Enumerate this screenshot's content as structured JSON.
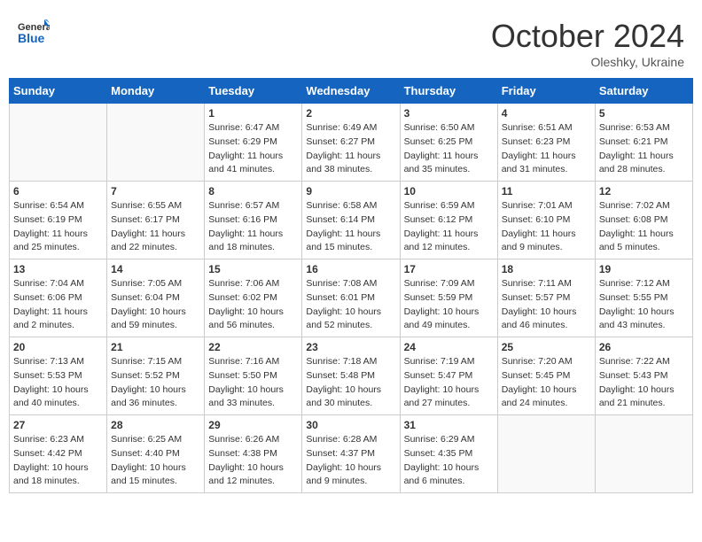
{
  "header": {
    "logo_line1": "General",
    "logo_line2": "Blue",
    "month": "October 2024",
    "location": "Oleshky, Ukraine"
  },
  "weekdays": [
    "Sunday",
    "Monday",
    "Tuesday",
    "Wednesday",
    "Thursday",
    "Friday",
    "Saturday"
  ],
  "weeks": [
    [
      {
        "day": "",
        "info": ""
      },
      {
        "day": "",
        "info": ""
      },
      {
        "day": "1",
        "info": "Sunrise: 6:47 AM\nSunset: 6:29 PM\nDaylight: 11 hours and 41 minutes."
      },
      {
        "day": "2",
        "info": "Sunrise: 6:49 AM\nSunset: 6:27 PM\nDaylight: 11 hours and 38 minutes."
      },
      {
        "day": "3",
        "info": "Sunrise: 6:50 AM\nSunset: 6:25 PM\nDaylight: 11 hours and 35 minutes."
      },
      {
        "day": "4",
        "info": "Sunrise: 6:51 AM\nSunset: 6:23 PM\nDaylight: 11 hours and 31 minutes."
      },
      {
        "day": "5",
        "info": "Sunrise: 6:53 AM\nSunset: 6:21 PM\nDaylight: 11 hours and 28 minutes."
      }
    ],
    [
      {
        "day": "6",
        "info": "Sunrise: 6:54 AM\nSunset: 6:19 PM\nDaylight: 11 hours and 25 minutes."
      },
      {
        "day": "7",
        "info": "Sunrise: 6:55 AM\nSunset: 6:17 PM\nDaylight: 11 hours and 22 minutes."
      },
      {
        "day": "8",
        "info": "Sunrise: 6:57 AM\nSunset: 6:16 PM\nDaylight: 11 hours and 18 minutes."
      },
      {
        "day": "9",
        "info": "Sunrise: 6:58 AM\nSunset: 6:14 PM\nDaylight: 11 hours and 15 minutes."
      },
      {
        "day": "10",
        "info": "Sunrise: 6:59 AM\nSunset: 6:12 PM\nDaylight: 11 hours and 12 minutes."
      },
      {
        "day": "11",
        "info": "Sunrise: 7:01 AM\nSunset: 6:10 PM\nDaylight: 11 hours and 9 minutes."
      },
      {
        "day": "12",
        "info": "Sunrise: 7:02 AM\nSunset: 6:08 PM\nDaylight: 11 hours and 5 minutes."
      }
    ],
    [
      {
        "day": "13",
        "info": "Sunrise: 7:04 AM\nSunset: 6:06 PM\nDaylight: 11 hours and 2 minutes."
      },
      {
        "day": "14",
        "info": "Sunrise: 7:05 AM\nSunset: 6:04 PM\nDaylight: 10 hours and 59 minutes."
      },
      {
        "day": "15",
        "info": "Sunrise: 7:06 AM\nSunset: 6:02 PM\nDaylight: 10 hours and 56 minutes."
      },
      {
        "day": "16",
        "info": "Sunrise: 7:08 AM\nSunset: 6:01 PM\nDaylight: 10 hours and 52 minutes."
      },
      {
        "day": "17",
        "info": "Sunrise: 7:09 AM\nSunset: 5:59 PM\nDaylight: 10 hours and 49 minutes."
      },
      {
        "day": "18",
        "info": "Sunrise: 7:11 AM\nSunset: 5:57 PM\nDaylight: 10 hours and 46 minutes."
      },
      {
        "day": "19",
        "info": "Sunrise: 7:12 AM\nSunset: 5:55 PM\nDaylight: 10 hours and 43 minutes."
      }
    ],
    [
      {
        "day": "20",
        "info": "Sunrise: 7:13 AM\nSunset: 5:53 PM\nDaylight: 10 hours and 40 minutes."
      },
      {
        "day": "21",
        "info": "Sunrise: 7:15 AM\nSunset: 5:52 PM\nDaylight: 10 hours and 36 minutes."
      },
      {
        "day": "22",
        "info": "Sunrise: 7:16 AM\nSunset: 5:50 PM\nDaylight: 10 hours and 33 minutes."
      },
      {
        "day": "23",
        "info": "Sunrise: 7:18 AM\nSunset: 5:48 PM\nDaylight: 10 hours and 30 minutes."
      },
      {
        "day": "24",
        "info": "Sunrise: 7:19 AM\nSunset: 5:47 PM\nDaylight: 10 hours and 27 minutes."
      },
      {
        "day": "25",
        "info": "Sunrise: 7:20 AM\nSunset: 5:45 PM\nDaylight: 10 hours and 24 minutes."
      },
      {
        "day": "26",
        "info": "Sunrise: 7:22 AM\nSunset: 5:43 PM\nDaylight: 10 hours and 21 minutes."
      }
    ],
    [
      {
        "day": "27",
        "info": "Sunrise: 6:23 AM\nSunset: 4:42 PM\nDaylight: 10 hours and 18 minutes."
      },
      {
        "day": "28",
        "info": "Sunrise: 6:25 AM\nSunset: 4:40 PM\nDaylight: 10 hours and 15 minutes."
      },
      {
        "day": "29",
        "info": "Sunrise: 6:26 AM\nSunset: 4:38 PM\nDaylight: 10 hours and 12 minutes."
      },
      {
        "day": "30",
        "info": "Sunrise: 6:28 AM\nSunset: 4:37 PM\nDaylight: 10 hours and 9 minutes."
      },
      {
        "day": "31",
        "info": "Sunrise: 6:29 AM\nSunset: 4:35 PM\nDaylight: 10 hours and 6 minutes."
      },
      {
        "day": "",
        "info": ""
      },
      {
        "day": "",
        "info": ""
      }
    ]
  ]
}
